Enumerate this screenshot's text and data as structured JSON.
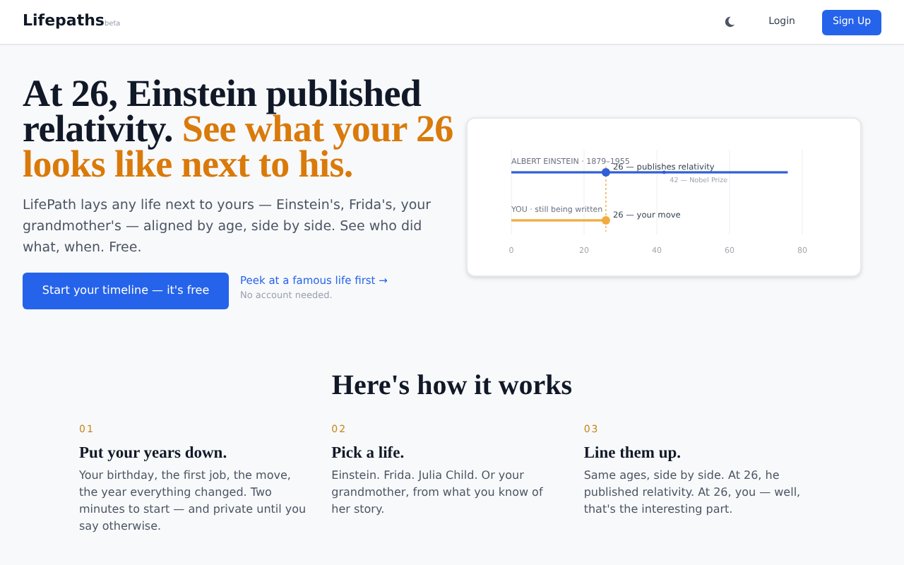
{
  "nav": {
    "brand": "Lifepaths",
    "badge": "beta",
    "login": "Login",
    "signup": "Sign Up"
  },
  "hero": {
    "headline": "At 26, Einstein published relativity.",
    "highlight": "See what your 26 looks like next to his.",
    "lede": "LifePath lays any life next to yours — Einstein's, Frida's, your grandmother's — aligned by age, side by side. See who did what, when. Free.",
    "cta": "Start your timeline — it's free",
    "peek": "Peek at a famous life first →",
    "note": "No account needed."
  },
  "timeline": {
    "axis_ticks": [
      "0",
      "20",
      "40",
      "60",
      "80"
    ],
    "lanes": [
      {
        "label": "ALBERT EINSTEIN · 1879–1955",
        "color": "#2f5fd6",
        "events": [
          {
            "kind": "major",
            "label": "26 — publishes relativity"
          },
          {
            "kind": "minor",
            "label": "42 — Nobel Prize"
          }
        ]
      },
      {
        "label": "YOU · still being written",
        "color": "#f2ab3c",
        "events": [
          {
            "kind": "major",
            "label": "26 — your move"
          }
        ]
      }
    ]
  },
  "how": {
    "title": "Here's how it works",
    "steps": [
      {
        "number": "01",
        "title": "Put your years down.",
        "text": "Your birthday, the first job, the move, the year everything changed. Two minutes to start — and private until you say otherwise."
      },
      {
        "number": "02",
        "title": "Pick a life.",
        "text": "Einstein. Frida. Julia Child. Or your grandmother, from what you know of her story."
      },
      {
        "number": "03",
        "title": "Line them up.",
        "text": "Same ages, side by side. At 26, he published relativity. At 26, you — well, that's the interesting part."
      }
    ]
  }
}
